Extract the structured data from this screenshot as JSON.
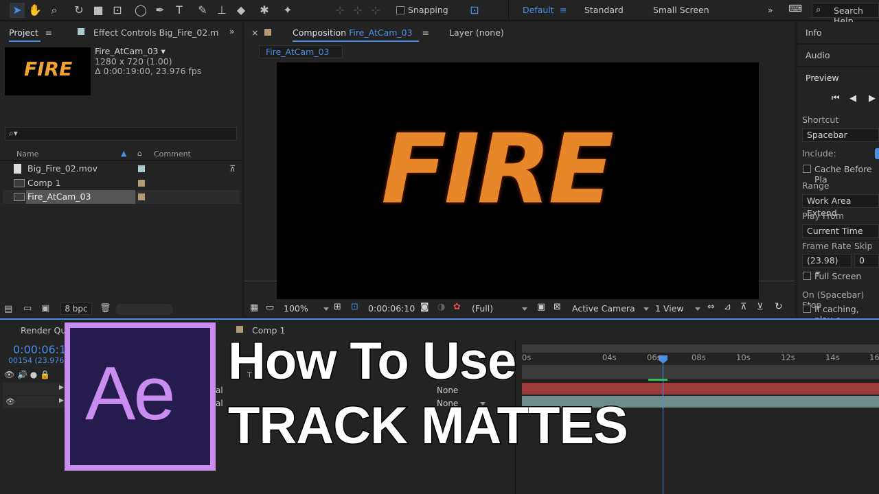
{
  "toolbar": {
    "snapping": "Snapping",
    "workspaces": [
      "Default",
      "Standard",
      "Small Screen"
    ],
    "search": "Search Help"
  },
  "project": {
    "tab": "Project",
    "effect_tab": "Effect Controls Big_Fire_02.m",
    "thumb_text": "FIRE",
    "comp_name": "Fire_AtCam_03 ▾",
    "comp_res": "1280 x 720 (1.00)",
    "comp_dur": "Δ 0:00:19:00, 23.976 fps",
    "search_icon": "⌕▾",
    "col_name": "Name",
    "col_comment": "Comment",
    "items": [
      {
        "name": "Big_Fire_02.mov",
        "label_color": "#a9c9cc"
      },
      {
        "name": "Comp 1",
        "label_color": "#b49a78"
      },
      {
        "name": "Fire_AtCam_03",
        "label_color": "#b49a78"
      }
    ],
    "bpc": "8 bpc"
  },
  "comp": {
    "tab_prefix": "Composition",
    "tab_name": "Fire_AtCam_03",
    "layer_tab": "Layer (none)",
    "sub_tab": "Fire_AtCam_03",
    "fire_text": "FIRE",
    "zoom": "100%",
    "timecode": "0:00:06:10",
    "resolution": "(Full)",
    "camera": "Active Camera",
    "views": "1 View"
  },
  "right": {
    "info": "Info",
    "audio": "Audio",
    "preview": "Preview",
    "shortcut_label": "Shortcut",
    "shortcut_value": "Spacebar",
    "include_label": "Include:",
    "cache": "Cache Before Pla",
    "range_label": "Range",
    "range_value": "Work Area Extend",
    "playfrom_label": "Play From",
    "playfrom_value": "Current Time",
    "framerate_label": "Frame Rate",
    "skip_label": "Skip",
    "framerate_value": "(23.98)",
    "skip_value": "0",
    "fullscreen": "Full Screen",
    "onspace": "On (Spacebar) Stop",
    "ifcaching": "If caching, play c"
  },
  "timeline": {
    "render_tab": "Render Que",
    "comp_tab": "Comp 1",
    "timecode": "0:00:06:1",
    "frames": "00154 (23.976",
    "ticks": [
      "0s",
      "04s",
      "06s",
      "08s",
      "10s",
      "12s",
      "14s",
      "16"
    ],
    "modes": [
      "al",
      "al"
    ],
    "parents": [
      "None",
      "None"
    ],
    "layer_t": "T"
  },
  "overlay": {
    "logo": "Ae",
    "line1": "How To Use",
    "line2": "TRACK MATTES"
  },
  "colors": {
    "accent": "#4a8fe7",
    "logo_border": "#c98df0",
    "logo_bg": "#261b4d",
    "track_red": "#9b3b3b",
    "track_teal": "#6f8c8c"
  }
}
